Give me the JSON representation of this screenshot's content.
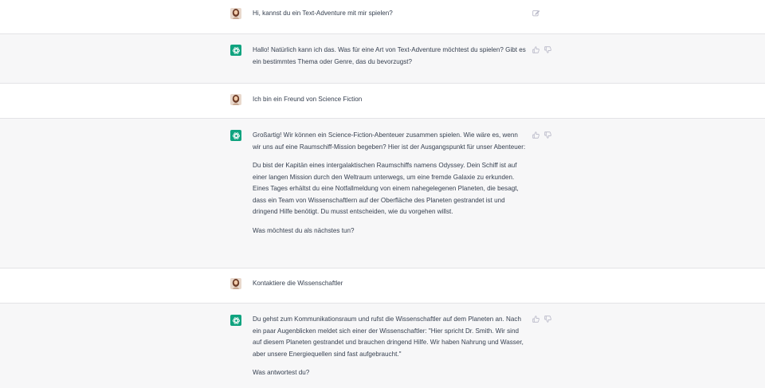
{
  "messages": [
    {
      "role": "user",
      "paragraphs": [
        "Hi, kannst du ein Text-Adventure mit mir spielen?"
      ]
    },
    {
      "role": "assistant",
      "paragraphs": [
        "Hallo! Natürlich kann ich das. Was für eine Art von Text-Adventure möchtest du spielen? Gibt es ein bestimmtes Thema oder Genre, das du bevorzugst?"
      ]
    },
    {
      "role": "user",
      "paragraphs": [
        "Ich bin ein Freund von Science Fiction"
      ]
    },
    {
      "role": "assistant",
      "paragraphs": [
        "Großartig! Wir können ein Science-Fiction-Abenteuer zusammen spielen. Wie wäre es, wenn wir uns auf eine Raumschiff-Mission begeben? Hier ist der Ausgangspunkt für unser Abenteuer:",
        "Du bist der Kapitän eines intergalaktischen Raumschiffs namens Odyssey. Dein Schiff ist auf einer langen Mission durch den Weltraum unterwegs, um eine fremde Galaxie zu erkunden. Eines Tages erhältst du eine Notfallmeldung von einem nahegelegenen Planeten, die besagt, dass ein Team von Wissenschaftlern auf der Oberfläche des Planeten gestrandet ist und dringend Hilfe benötigt. Du musst entscheiden, wie du vorgehen willst.",
        "Was möchtest du als nächstes tun?"
      ]
    },
    {
      "role": "user",
      "paragraphs": [
        "Kontaktiere die Wissenschaftler"
      ]
    },
    {
      "role": "assistant",
      "paragraphs": [
        "Du gehst zum Kommunikationsraum und rufst die Wissenschaftler auf dem Planeten an. Nach ein paar Augenblicken meldet sich einer der Wissenschaftler: \"Hier spricht Dr. Smith. Wir sind auf diesem Planeten gestrandet und brauchen dringend Hilfe. Wir haben Nahrung und Wasser, aber unsere Energiequellen sind fast aufgebraucht.\"",
        "Was antwortest du?"
      ]
    }
  ],
  "icons": {
    "user_avatar": "user-avatar-photo",
    "assistant_avatar": "openai-logo-icon",
    "edit": "edit-icon",
    "thumbs_up": "thumbs-up-icon",
    "thumbs_down": "thumbs-down-icon"
  },
  "colors": {
    "assistant_bg": "#f7f7f8",
    "user_bg": "#ffffff",
    "brand": "#10a37f",
    "text": "#374151",
    "icon": "#acacbe"
  }
}
